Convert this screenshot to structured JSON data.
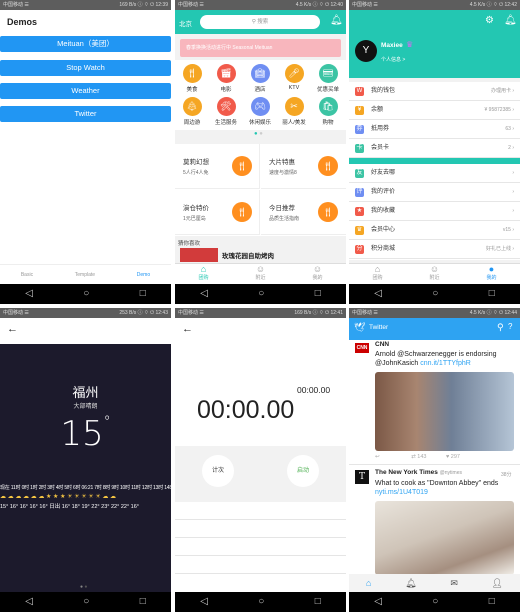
{
  "status": {
    "s1": {
      "carrier": "中国移动 ☰",
      "right": "169 B/s ⓘ ⌔ ⏻ 12:39"
    },
    "s2": {
      "carrier": "中国移动 ☰",
      "right": "4.5 K/s ⓘ ⌔ ⏻ 12:40"
    },
    "s3": {
      "carrier": "中国移动 ☰",
      "right": "4.5 K/s ⓘ ⌔ ⏻ 12:42"
    },
    "s4": {
      "carrier": "中国移动 ☰",
      "right": "253 B/s ⓘ ⌔ ⏻ 12:43"
    },
    "s5": {
      "carrier": "中国移动 ☰",
      "right": "169 B/s ⓘ ⌔ ⏻ 12:41"
    },
    "s6": {
      "carrier": "中国移动 ☰",
      "right": "4.5 K/s ⓘ ⌔ ⏻ 12:44"
    }
  },
  "demos": {
    "title": "Demos",
    "buttons": [
      "Meituan（美团）",
      "Stop Watch",
      "Weather",
      "Twitter"
    ],
    "tabs": [
      "Basic",
      "Template",
      "Demo"
    ]
  },
  "meituan": {
    "city": "北京",
    "search_placeholder": "搜索",
    "banner": "春季换换活动进行中 Seasonal Meituan",
    "grid": [
      {
        "label": "美食",
        "color": "#f5a623"
      },
      {
        "label": "电影",
        "color": "#f15a4a"
      },
      {
        "label": "酒店",
        "color": "#6f8ef2"
      },
      {
        "label": "KTV",
        "color": "#f5a623"
      },
      {
        "label": "优惠买单",
        "color": "#3cc4a4"
      },
      {
        "label": "周边游",
        "color": "#f5a623"
      },
      {
        "label": "生活服务",
        "color": "#f15a4a"
      },
      {
        "label": "休闲娱乐",
        "color": "#6f8ef2"
      },
      {
        "label": "丽人/美发",
        "color": "#f5a623"
      },
      {
        "label": "购物",
        "color": "#3cc4a4"
      }
    ],
    "cards": [
      {
        "title": "莫莉幻想",
        "sub": "5人行4人免"
      },
      {
        "title": "大片特惠",
        "sub": "速度与激情8"
      },
      {
        "title": "演仓特价",
        "sub": "1元巴厘岛"
      },
      {
        "title": "今日推荐",
        "sub": "品质生活指南"
      }
    ],
    "guess": "猜你喜欢",
    "listing": "玫瑰花园自助烤肉",
    "tabs": [
      "团购",
      "附近",
      "我的"
    ]
  },
  "profile": {
    "name": "Maxiee",
    "sub": "个人信息 >",
    "avatar": "Y",
    "rows1": [
      {
        "label": "我的钱包",
        "right": "办理用卡 ›",
        "color": "#f15a4a",
        "icon": "W"
      },
      {
        "label": "余额",
        "right": "¥ 95872385 ›",
        "color": "#f5a623",
        "icon": "¥"
      },
      {
        "label": "抵用券",
        "right": "63 ›",
        "color": "#6f8ef2",
        "icon": "券"
      },
      {
        "label": "会员卡",
        "right": "2 ›",
        "color": "#3cc4a4",
        "icon": "卡"
      }
    ],
    "rows2": [
      {
        "label": "好友去哪",
        "right": "›",
        "color": "#3cc4a4",
        "icon": "友"
      },
      {
        "label": "我的评价",
        "right": "›",
        "color": "#6f8ef2",
        "icon": "评"
      },
      {
        "label": "我的收藏",
        "right": "›",
        "color": "#f15a4a",
        "icon": "★"
      },
      {
        "label": "会员中心",
        "right": "v15 ›",
        "color": "#f5a623",
        "icon": "♛"
      },
      {
        "label": "积分商城",
        "right": "好礼已上线 ›",
        "color": "#f15a4a",
        "icon": "分"
      }
    ],
    "tabs": [
      "团购",
      "附近",
      "我的"
    ]
  },
  "weather": {
    "city": "福州",
    "cond": "大部晴朗",
    "temp": "15",
    "deg": "°",
    "hours_label": "现在  11时 0时 1时 2时 3时 4时 5时 6时 06:21 7时 8时 9时 10时 11时 12时 13时 14时 15时",
    "hours_temps": "15° 16° 16° 16° 16° 日出 16° 18° 19° 22° 23° 22° 22° 16°"
  },
  "stopwatch": {
    "main": "00:00.00",
    "lap": "00:00.00",
    "lap_button": "计次",
    "start_button": "启动"
  },
  "twitter": {
    "title": "Twitter",
    "tweets": [
      {
        "source": "CNN",
        "text": "Arnold @Schwarzenegger is endorsing @JohnKasich",
        "link": "cnn.it/1TTYfphR",
        "retweets": "143",
        "likes": "297"
      },
      {
        "source": "The New York Times",
        "handle": "@nytimes",
        "time": "38分",
        "text": "What to cook as \"Downton Abbey\" ends",
        "link": "nyti.ms/1U4T019"
      }
    ]
  },
  "colors": {
    "blue": "#2196f3",
    "teal": "#23c7b2",
    "orange": "#ff8f1f",
    "twitter": "#2ea3f2",
    "weather_bg": "#1c1a2c"
  }
}
